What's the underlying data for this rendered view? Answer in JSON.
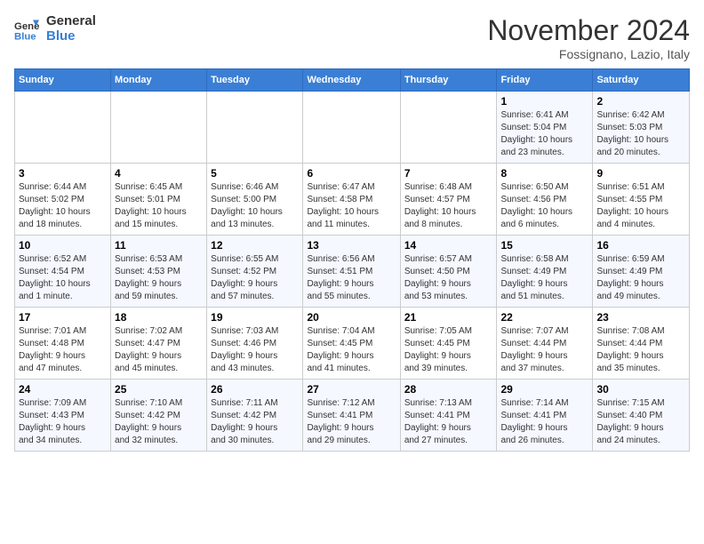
{
  "header": {
    "logo_line1": "General",
    "logo_line2": "Blue",
    "month": "November 2024",
    "location": "Fossignano, Lazio, Italy"
  },
  "weekdays": [
    "Sunday",
    "Monday",
    "Tuesday",
    "Wednesday",
    "Thursday",
    "Friday",
    "Saturday"
  ],
  "weeks": [
    [
      {
        "day": "",
        "info": ""
      },
      {
        "day": "",
        "info": ""
      },
      {
        "day": "",
        "info": ""
      },
      {
        "day": "",
        "info": ""
      },
      {
        "day": "",
        "info": ""
      },
      {
        "day": "1",
        "info": "Sunrise: 6:41 AM\nSunset: 5:04 PM\nDaylight: 10 hours\nand 23 minutes."
      },
      {
        "day": "2",
        "info": "Sunrise: 6:42 AM\nSunset: 5:03 PM\nDaylight: 10 hours\nand 20 minutes."
      }
    ],
    [
      {
        "day": "3",
        "info": "Sunrise: 6:44 AM\nSunset: 5:02 PM\nDaylight: 10 hours\nand 18 minutes."
      },
      {
        "day": "4",
        "info": "Sunrise: 6:45 AM\nSunset: 5:01 PM\nDaylight: 10 hours\nand 15 minutes."
      },
      {
        "day": "5",
        "info": "Sunrise: 6:46 AM\nSunset: 5:00 PM\nDaylight: 10 hours\nand 13 minutes."
      },
      {
        "day": "6",
        "info": "Sunrise: 6:47 AM\nSunset: 4:58 PM\nDaylight: 10 hours\nand 11 minutes."
      },
      {
        "day": "7",
        "info": "Sunrise: 6:48 AM\nSunset: 4:57 PM\nDaylight: 10 hours\nand 8 minutes."
      },
      {
        "day": "8",
        "info": "Sunrise: 6:50 AM\nSunset: 4:56 PM\nDaylight: 10 hours\nand 6 minutes."
      },
      {
        "day": "9",
        "info": "Sunrise: 6:51 AM\nSunset: 4:55 PM\nDaylight: 10 hours\nand 4 minutes."
      }
    ],
    [
      {
        "day": "10",
        "info": "Sunrise: 6:52 AM\nSunset: 4:54 PM\nDaylight: 10 hours\nand 1 minute."
      },
      {
        "day": "11",
        "info": "Sunrise: 6:53 AM\nSunset: 4:53 PM\nDaylight: 9 hours\nand 59 minutes."
      },
      {
        "day": "12",
        "info": "Sunrise: 6:55 AM\nSunset: 4:52 PM\nDaylight: 9 hours\nand 57 minutes."
      },
      {
        "day": "13",
        "info": "Sunrise: 6:56 AM\nSunset: 4:51 PM\nDaylight: 9 hours\nand 55 minutes."
      },
      {
        "day": "14",
        "info": "Sunrise: 6:57 AM\nSunset: 4:50 PM\nDaylight: 9 hours\nand 53 minutes."
      },
      {
        "day": "15",
        "info": "Sunrise: 6:58 AM\nSunset: 4:49 PM\nDaylight: 9 hours\nand 51 minutes."
      },
      {
        "day": "16",
        "info": "Sunrise: 6:59 AM\nSunset: 4:49 PM\nDaylight: 9 hours\nand 49 minutes."
      }
    ],
    [
      {
        "day": "17",
        "info": "Sunrise: 7:01 AM\nSunset: 4:48 PM\nDaylight: 9 hours\nand 47 minutes."
      },
      {
        "day": "18",
        "info": "Sunrise: 7:02 AM\nSunset: 4:47 PM\nDaylight: 9 hours\nand 45 minutes."
      },
      {
        "day": "19",
        "info": "Sunrise: 7:03 AM\nSunset: 4:46 PM\nDaylight: 9 hours\nand 43 minutes."
      },
      {
        "day": "20",
        "info": "Sunrise: 7:04 AM\nSunset: 4:45 PM\nDaylight: 9 hours\nand 41 minutes."
      },
      {
        "day": "21",
        "info": "Sunrise: 7:05 AM\nSunset: 4:45 PM\nDaylight: 9 hours\nand 39 minutes."
      },
      {
        "day": "22",
        "info": "Sunrise: 7:07 AM\nSunset: 4:44 PM\nDaylight: 9 hours\nand 37 minutes."
      },
      {
        "day": "23",
        "info": "Sunrise: 7:08 AM\nSunset: 4:44 PM\nDaylight: 9 hours\nand 35 minutes."
      }
    ],
    [
      {
        "day": "24",
        "info": "Sunrise: 7:09 AM\nSunset: 4:43 PM\nDaylight: 9 hours\nand 34 minutes."
      },
      {
        "day": "25",
        "info": "Sunrise: 7:10 AM\nSunset: 4:42 PM\nDaylight: 9 hours\nand 32 minutes."
      },
      {
        "day": "26",
        "info": "Sunrise: 7:11 AM\nSunset: 4:42 PM\nDaylight: 9 hours\nand 30 minutes."
      },
      {
        "day": "27",
        "info": "Sunrise: 7:12 AM\nSunset: 4:41 PM\nDaylight: 9 hours\nand 29 minutes."
      },
      {
        "day": "28",
        "info": "Sunrise: 7:13 AM\nSunset: 4:41 PM\nDaylight: 9 hours\nand 27 minutes."
      },
      {
        "day": "29",
        "info": "Sunrise: 7:14 AM\nSunset: 4:41 PM\nDaylight: 9 hours\nand 26 minutes."
      },
      {
        "day": "30",
        "info": "Sunrise: 7:15 AM\nSunset: 4:40 PM\nDaylight: 9 hours\nand 24 minutes."
      }
    ]
  ]
}
